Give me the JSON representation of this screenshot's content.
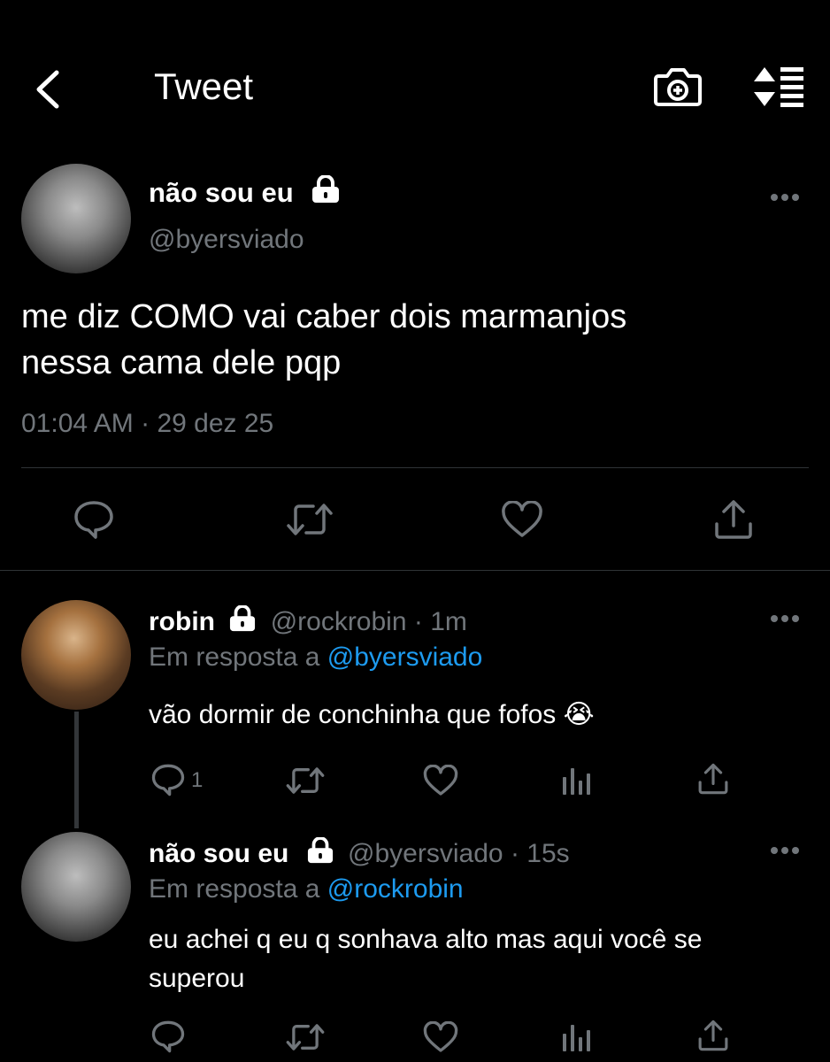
{
  "header": {
    "title": "Tweet",
    "back_icon": "chevron-left-icon",
    "camera_icon": "camera-add-icon",
    "sort_icon": "sort-list-icon"
  },
  "main_tweet": {
    "display_name": "não sou eu",
    "handle": "@byersviado",
    "text_line1": "me diz COMO vai caber dois marmanjos",
    "text_line2": "nessa cama dele pqp",
    "time": "01:04 AM",
    "separator": "·",
    "date": "29 dez 25"
  },
  "replies": [
    {
      "display_name": "robin",
      "handle": "@rockrobin",
      "separator": "·",
      "age": "1m",
      "reply_prefix": "Em resposta a",
      "reply_to": "@byersviado",
      "text": "vão dormir de conchinha que fofos 😭",
      "reply_count": "1"
    },
    {
      "display_name": "não sou eu",
      "handle": "@byersviado",
      "separator": "·",
      "age": "15s",
      "reply_prefix": "Em resposta a",
      "reply_to": "@rockrobin",
      "text_line1": "eu achei q eu q sonhava alto mas aqui você se",
      "text_line2": "superou"
    }
  ],
  "colors": {
    "background": "#000000",
    "text": "#ffffff",
    "secondary": "#71767b",
    "link": "#1d9bf0",
    "divider": "#2f3336"
  }
}
